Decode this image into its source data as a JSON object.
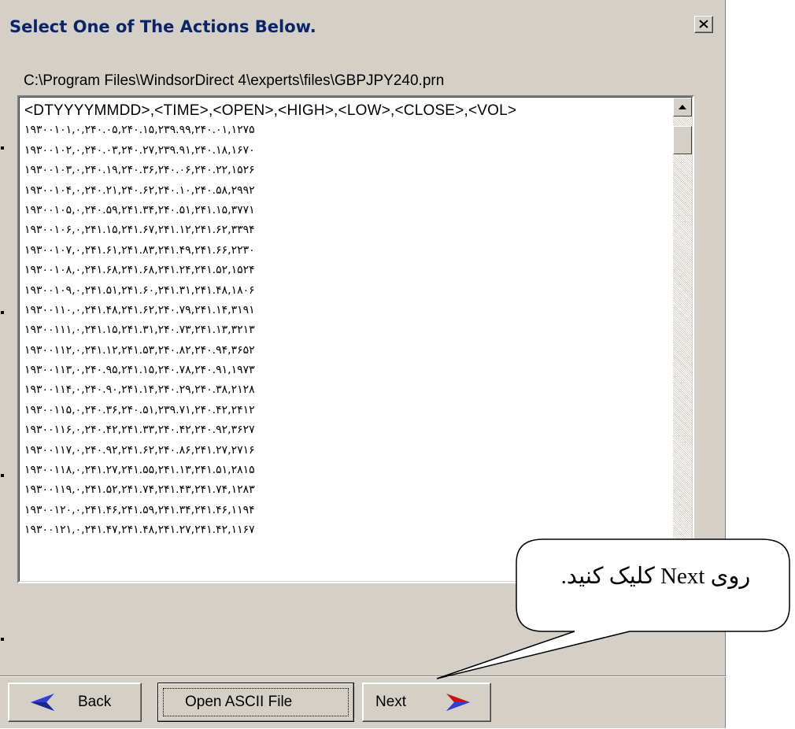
{
  "window": {
    "title": "Select One of The Actions Below.",
    "close_glyph": "X"
  },
  "file_path": "C:\\Program Files\\WindsorDirect 4\\experts\\files\\GBPJPY240.prn",
  "listbox": {
    "header": "<DTYYYYMMDD>,<TIME>,<OPEN>,<HIGH>,<LOW>,<CLOSE>,<VOL>",
    "rows": [
      "۱۹۳۰۰۱۰۱,۰,۲۴۰.۰۵,۲۴۰.۱۵,۲۳۹.۹۹,۲۴۰.۰۱,۱۲۷۵",
      "۱۹۳۰۰۱۰۲,۰,۲۴۰.۰۳,۲۴۰.۲۷,۲۳۹.۹۱,۲۴۰.۱۸,۱۶۷۰",
      "۱۹۳۰۰۱۰۳,۰,۲۴۰.۱۹,۲۴۰.۳۶,۲۴۰.۰۶,۲۴۰.۲۲,۱۵۲۶",
      "۱۹۳۰۰۱۰۴,۰,۲۴۰.۲۱,۲۴۰.۶۲,۲۴۰.۱۰,۲۴۰.۵۸,۲۹۹۲",
      "۱۹۳۰۰۱۰۵,۰,۲۴۰.۵۹,۲۴۱.۳۴,۲۴۰.۵۱,۲۴۱.۱۵,۳۷۷۱",
      "۱۹۳۰۰۱۰۶,۰,۲۴۱.۱۵,۲۴۱.۶۷,۲۴۱.۱۲,۲۴۱.۶۲,۳۳۹۴",
      "۱۹۳۰۰۱۰۷,۰,۲۴۱.۶۱,۲۴۱.۸۳,۲۴۱.۴۹,۲۴۱.۶۶,۲۲۳۰",
      "۱۹۳۰۰۱۰۸,۰,۲۴۱.۶۸,۲۴۱.۶۸,۲۴۱.۲۴,۲۴۱.۵۲,۱۵۲۴",
      "۱۹۳۰۰۱۰۹,۰,۲۴۱.۵۱,۲۴۱.۶۰,۲۴۱.۳۱,۲۴۱.۴۸,۱۸۰۶",
      "۱۹۳۰۰۱۱۰,۰,۲۴۱.۴۸,۲۴۱.۶۲,۲۴۰.۷۹,۲۴۱.۱۴,۳۱۹۱",
      "۱۹۳۰۰۱۱۱,۰,۲۴۱.۱۵,۲۴۱.۳۱,۲۴۰.۷۳,۲۴۱.۱۳,۳۲۱۳",
      "۱۹۳۰۰۱۱۲,۰,۲۴۱.۱۲,۲۴۱.۵۳,۲۴۰.۸۲,۲۴۰.۹۴,۳۶۵۲",
      "۱۹۳۰۰۱۱۳,۰,۲۴۰.۹۵,۲۴۱.۱۵,۲۴۰.۷۸,۲۴۰.۹۱,۱۹۷۳",
      "۱۹۳۰۰۱۱۴,۰,۲۴۰.۹۰,۲۴۱.۱۴,۲۴۰.۲۹,۲۴۰.۳۸,۲۱۲۸",
      "۱۹۳۰۰۱۱۵,۰,۲۴۰.۳۶,۲۴۰.۵۱,۲۳۹.۷۱,۲۴۰.۴۲,۲۴۱۲",
      "۱۹۳۰۰۱۱۶,۰,۲۴۰.۴۲,۲۴۱.۳۳,۲۴۰.۴۲,۲۴۰.۹۲,۳۶۲۷",
      "۱۹۳۰۰۱۱۷,۰,۲۴۰.۹۲,۲۴۱.۶۲,۲۴۰.۸۶,۲۴۱.۲۷,۲۷۱۶",
      "۱۹۳۰۰۱۱۸,۰,۲۴۱.۲۷,۲۴۱.۵۵,۲۴۱.۱۳,۲۴۱.۵۱,۲۸۱۵",
      "۱۹۳۰۰۱۱۹,۰,۲۴۱.۵۲,۲۴۱.۷۴,۲۴۱.۴۳,۲۴۱.۷۴,۱۲۸۳",
      "۱۹۳۰۰۱۲۰,۰,۲۴۱.۴۶,۲۴۱.۵۹,۲۴۱.۳۴,۲۴۱.۴۶,۱۱۹۴",
      "۱۹۳۰۰۱۲۱,۰,۲۴۱.۴۷,۲۴۱.۴۸,۲۴۱.۲۷,۲۴۱.۴۲,۱۱۶۷"
    ]
  },
  "buttons": {
    "back": "Back",
    "open_ascii": "Open ASCII File",
    "next": "Next"
  },
  "callout": {
    "text": "روی  Next کلیک کنید."
  },
  "colors": {
    "dialog_bg": "#d4d0c8",
    "title_text": "#0a246a",
    "arrow_back": "#3040d0",
    "arrow_next": "#d01010"
  },
  "icons": {
    "back": "left-arrow-icon",
    "next": "right-arrow-icon",
    "close": "close-icon"
  }
}
